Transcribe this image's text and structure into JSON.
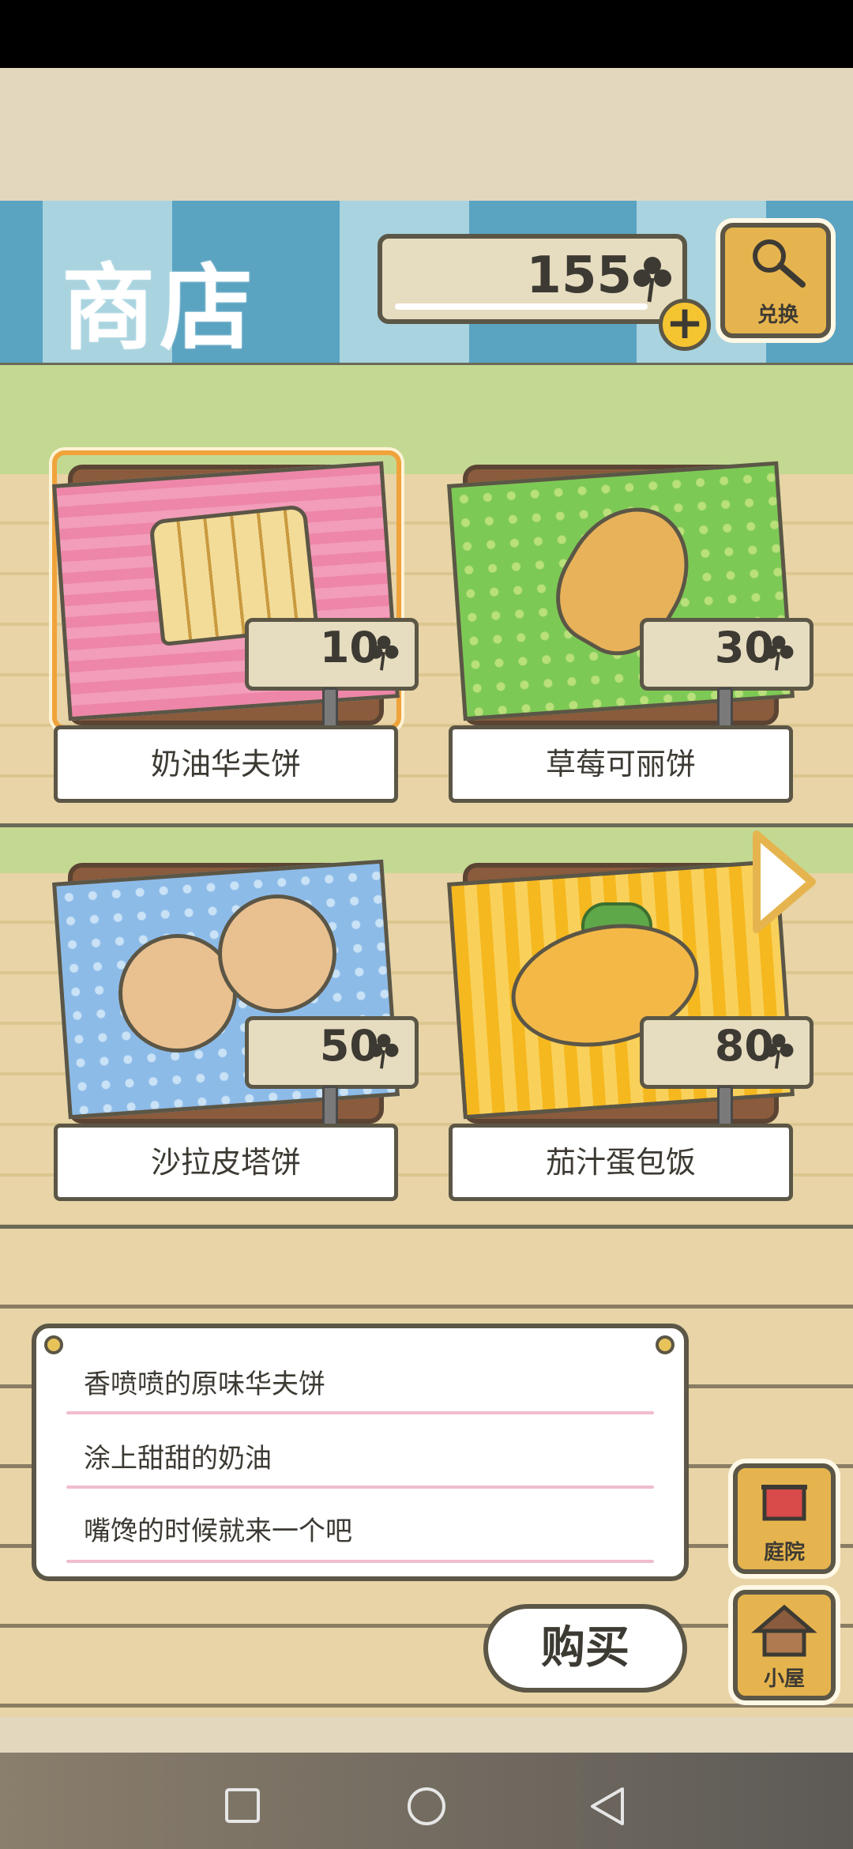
{
  "header": {
    "title": "商店",
    "currency_amount": "155",
    "currency_icon": "clover-icon",
    "exchange_label": "兑换"
  },
  "items": [
    {
      "name": "奶油华夫饼",
      "price": "10",
      "cloth_color": "#f6b9cf",
      "selected": true
    },
    {
      "name": "草莓可丽饼",
      "price": "30",
      "cloth_color": "#7dc955",
      "selected": false
    },
    {
      "name": "沙拉皮塔饼",
      "price": "50",
      "cloth_color": "#8dbbe8",
      "selected": false
    },
    {
      "name": "茄汁蛋包饭",
      "price": "80",
      "cloth_color": "#f5b81f",
      "selected": false
    }
  ],
  "description": {
    "lines": [
      "香喷喷的原味华夫饼",
      "涂上甜甜的奶油",
      "嘴馋的时候就来一个吧"
    ]
  },
  "buttons": {
    "buy": "购买",
    "yard": "庭院",
    "house": "小屋"
  },
  "colors": {
    "accent_orange": "#f0a33b",
    "button_gold": "#e6b44e",
    "header_blue": "#5aa3c1",
    "outline": "#5b5646"
  }
}
